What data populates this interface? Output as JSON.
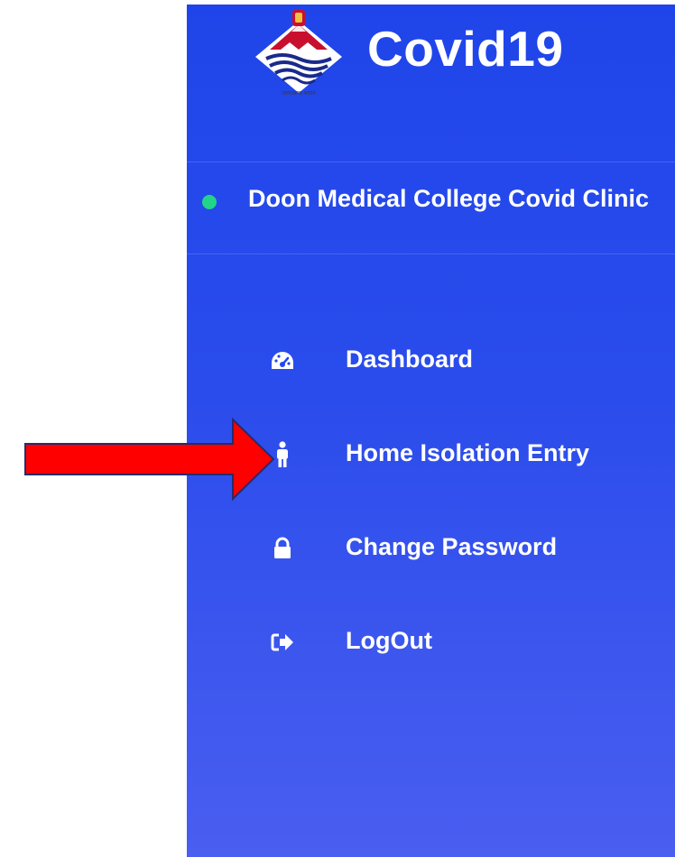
{
  "app": {
    "title": "Covid19",
    "logo_caption": "उत्तराखण्ड शासन",
    "logo_icon": "uttarakhand-emblem-icon"
  },
  "user": {
    "name": "Doon Medical College Covid Clinic",
    "status": "online",
    "status_color": "#22d48a"
  },
  "menu": {
    "items": [
      {
        "label": "Dashboard",
        "icon": "dashboard-gauge-icon"
      },
      {
        "label": "Home Isolation Entry",
        "icon": "person-icon"
      },
      {
        "label": "Change Password",
        "icon": "lock-icon"
      },
      {
        "label": "LogOut",
        "icon": "sign-out-icon"
      }
    ]
  },
  "annotation": {
    "icon": "red-arrow-icon",
    "color": "#ff0000",
    "points_to": "Home Isolation Entry"
  },
  "colors": {
    "sidebar_top": "#1f45ea",
    "sidebar_bottom": "#4a5ef0",
    "text": "#ffffff"
  }
}
